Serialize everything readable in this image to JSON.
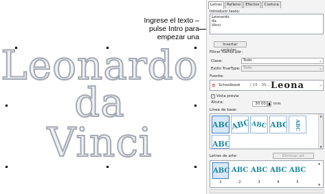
{
  "canvas": {
    "lines": [
      "Leonardo",
      "da",
      "Vinci"
    ],
    "callout": "Ingrese el texto – pulse Intro para empezar una"
  },
  "panel": {
    "tabs": [
      "Letras",
      "Relleno",
      "Efectos",
      "Costura"
    ],
    "text_label": "Introducir texto:",
    "text_value": [
      "Leonardo",
      "da",
      "Vinci"
    ],
    "insert_char_button": "Insertar carácter...",
    "filter_label": "Filtrar fuente por:",
    "class_label": "Clase:",
    "class_value": "Todo",
    "truetype_label": "Estilo TrueType:",
    "truetype_value": "Todo",
    "font_label": "Fuente:",
    "font_name": "Schoolbook",
    "font_size_range": "( 15 - 30...",
    "font_preview": "Leona",
    "preview_label": "Vista previa",
    "height_label": "Altura:",
    "height_value": "30.00",
    "height_unit": "mm",
    "baseline_label": "Línea de base:",
    "art_label": "Letras de arte:",
    "delete_art_button": "Eliminar art",
    "abc": "ABC",
    "art_numbers": [
      "1",
      "2",
      "3",
      "4",
      "5"
    ]
  },
  "icons": {
    "font": "truetype-font-icon",
    "dropdown": "chevron-down-icon",
    "check": "check-icon"
  },
  "colors": {
    "embroidery_stroke": "#a4a9b3",
    "abc_teal": "#1b8aa0",
    "selection": "#d9e8f7"
  }
}
